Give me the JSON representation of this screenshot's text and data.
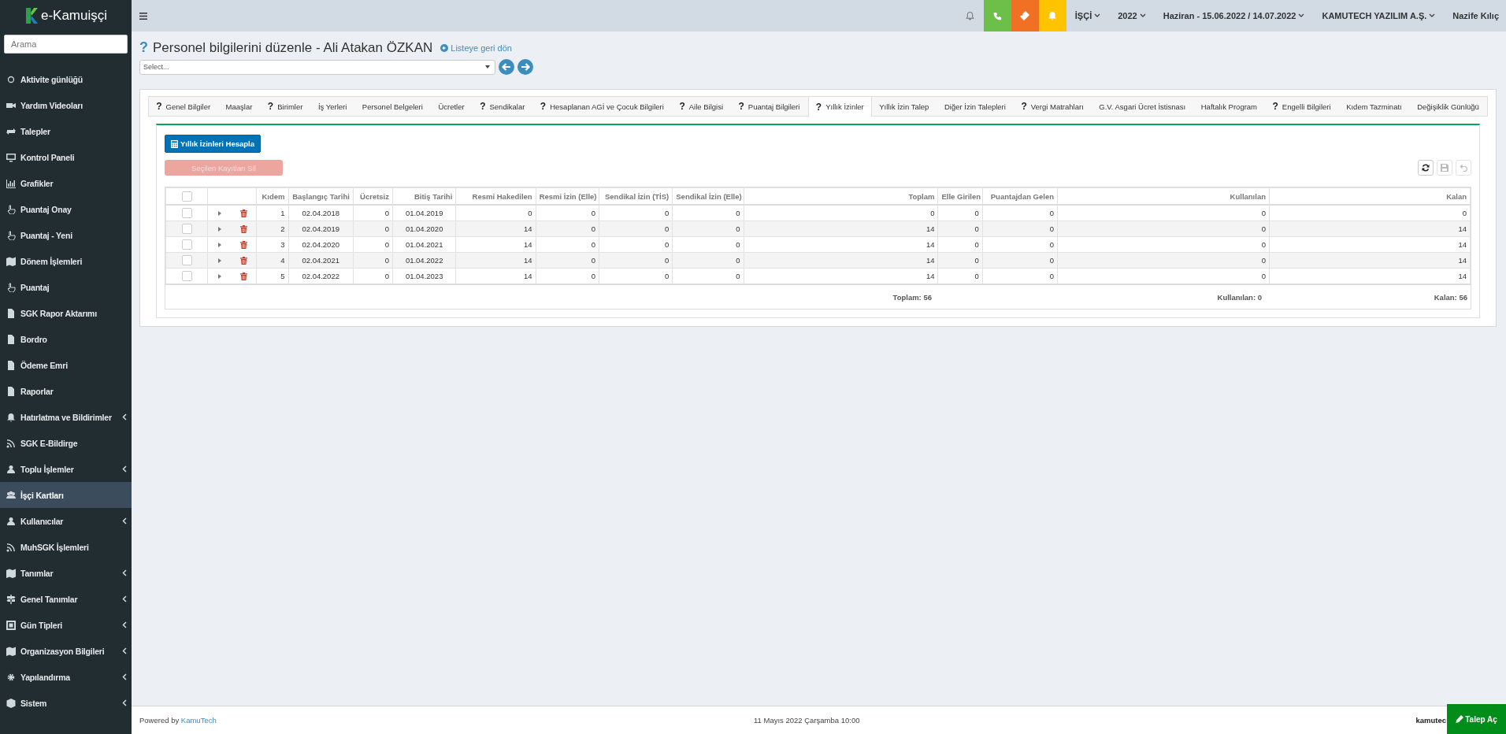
{
  "app": {
    "logo": "e-Kamuişçi",
    "search_placeholder": "Arama"
  },
  "sidebar": {
    "items": [
      {
        "label": "Aktivite günlüğü",
        "expandable": false,
        "selected": false
      },
      {
        "label": "Yardım Videoları",
        "expandable": false,
        "selected": false
      },
      {
        "label": "Talepler",
        "expandable": false,
        "selected": false
      },
      {
        "label": "Kontrol Paneli",
        "expandable": false,
        "selected": false
      },
      {
        "label": "Grafikler",
        "expandable": false,
        "selected": false
      },
      {
        "label": "Puantaj Onay",
        "expandable": false,
        "selected": false
      },
      {
        "label": "Puantaj - Yeni",
        "expandable": false,
        "selected": false
      },
      {
        "label": "Dönem İşlemleri",
        "expandable": false,
        "selected": false
      },
      {
        "label": "Puantaj",
        "expandable": false,
        "selected": false
      },
      {
        "label": "SGK Rapor Aktarımı",
        "expandable": false,
        "selected": false
      },
      {
        "label": "Bordro",
        "expandable": false,
        "selected": false
      },
      {
        "label": "Ödeme Emri",
        "expandable": false,
        "selected": false
      },
      {
        "label": "Raporlar",
        "expandable": false,
        "selected": false
      },
      {
        "label": "Hatırlatma ve Bildirimler",
        "expandable": true,
        "selected": false
      },
      {
        "label": "SGK E-Bildirge",
        "expandable": false,
        "selected": false
      },
      {
        "label": "Toplu İşlemler",
        "expandable": true,
        "selected": false
      },
      {
        "label": "İşçi Kartları",
        "expandable": false,
        "selected": true
      },
      {
        "label": "Kullanıcılar",
        "expandable": true,
        "selected": false
      },
      {
        "label": "MuhSGK İşlemleri",
        "expandable": false,
        "selected": false
      },
      {
        "label": "Tanımlar",
        "expandable": true,
        "selected": false
      },
      {
        "label": "Genel Tanımlar",
        "expandable": true,
        "selected": false
      },
      {
        "label": "Gün Tipleri",
        "expandable": true,
        "selected": false
      },
      {
        "label": "Organizasyon Bilgileri",
        "expandable": true,
        "selected": false
      },
      {
        "label": "Yapılandırma",
        "expandable": true,
        "selected": false
      },
      {
        "label": "Sistem",
        "expandable": true,
        "selected": false
      }
    ]
  },
  "topbar": {
    "dropdowns": [
      "İŞÇİ",
      "2022",
      "Haziran - 15.06.2022 / 14.07.2022",
      "KAMUTECH YAZILIM A.Ş."
    ],
    "user": "Nazife Kılıç"
  },
  "page": {
    "help": "?",
    "title": "Personel bilgilerini düzenle - Ali Atakan ÖZKAN",
    "back_link": "Listeye geri dön",
    "select_placeholder": "Select..."
  },
  "tabs": [
    {
      "label": "Genel Bilgiler",
      "help": true,
      "selected": false
    },
    {
      "label": "Maaşlar",
      "help": false,
      "selected": false
    },
    {
      "label": "Birimler",
      "help": true,
      "selected": false
    },
    {
      "label": "İş Yerleri",
      "help": false,
      "selected": false
    },
    {
      "label": "Personel Belgeleri",
      "help": false,
      "selected": false
    },
    {
      "label": "Ücretler",
      "help": false,
      "selected": false
    },
    {
      "label": "Sendikalar",
      "help": true,
      "selected": false
    },
    {
      "label": "Hesaplanan AGİ ve Çocuk Bilgileri",
      "help": true,
      "selected": false
    },
    {
      "label": "Aile Bilgisi",
      "help": true,
      "selected": false
    },
    {
      "label": "Puantaj Bilgileri",
      "help": true,
      "selected": false
    },
    {
      "label": "Yıllık İzinler",
      "help": true,
      "selected": true
    },
    {
      "label": "Yıllık İzin Talep",
      "help": false,
      "selected": false
    },
    {
      "label": "Diğer İzin Talepleri",
      "help": false,
      "selected": false
    },
    {
      "label": "Vergi Matrahları",
      "help": true,
      "selected": false
    },
    {
      "label": "G.V. Asgari Ücret İstisnası",
      "help": false,
      "selected": false
    },
    {
      "label": "Haftalık Program",
      "help": false,
      "selected": false
    },
    {
      "label": "Engelli Bilgileri",
      "help": true,
      "selected": false
    },
    {
      "label": "Kıdem Tazminatı",
      "help": false,
      "selected": false
    },
    {
      "label": "Değişiklik Günlüğü",
      "help": false,
      "selected": false
    }
  ],
  "help_mark": "?",
  "actions": {
    "calculate": {
      "label": "Yıllık İzinleri Hesapla",
      "disabled": false
    },
    "delete": {
      "label": "Seçilen Kayıtları Sil",
      "disabled": true
    },
    "toolbar": [
      {
        "kind": "refresh",
        "disabled": false
      },
      {
        "kind": "save",
        "disabled": true
      },
      {
        "kind": "undo",
        "disabled": true
      }
    ]
  },
  "table": {
    "all_checked": false,
    "columns": [
      "Kıdem",
      "Başlangıç Tarihi",
      "Ücretsiz",
      "Bitiş Tarihi",
      "Resmi Hakedilen",
      "Resmi İzin (Elle)",
      "Sendikal İzin (TİS)",
      "Sendikal İzin (Elle)",
      "Toplam",
      "Elle Girilen",
      "Puantajdan Gelen",
      "Kullanılan",
      "Kalan"
    ],
    "rows": [
      {
        "checked": false,
        "cells": [
          "1",
          "02.04.2018",
          "0",
          "01.04.2019",
          "0",
          "0",
          "0",
          "0",
          "0",
          "0",
          "0",
          "0",
          "0"
        ]
      },
      {
        "checked": false,
        "cells": [
          "2",
          "02.04.2019",
          "0",
          "01.04.2020",
          "14",
          "0",
          "0",
          "0",
          "14",
          "0",
          "0",
          "0",
          "14"
        ]
      },
      {
        "checked": false,
        "cells": [
          "3",
          "02.04.2020",
          "0",
          "01.04.2021",
          "14",
          "0",
          "0",
          "0",
          "14",
          "0",
          "0",
          "0",
          "14"
        ]
      },
      {
        "checked": false,
        "cells": [
          "4",
          "02.04.2021",
          "0",
          "01.04.2022",
          "14",
          "0",
          "0",
          "0",
          "14",
          "0",
          "0",
          "0",
          "14"
        ]
      },
      {
        "checked": false,
        "cells": [
          "5",
          "02.04.2022",
          "0",
          "01.04.2023",
          "14",
          "0",
          "0",
          "0",
          "14",
          "0",
          "0",
          "0",
          "14"
        ]
      }
    ],
    "totals": {
      "toplam": "Toplam: 56",
      "kullanilan": "Kullanılan: 0",
      "kalan": "Kalan: 56"
    }
  },
  "footer": {
    "powered": "Powered by",
    "brand_link": "KamuTech",
    "datetime": "11 Mayıs 2022 Çarşamba 10:00",
    "right": "kamutec",
    "request_button": "Talep Aç"
  }
}
